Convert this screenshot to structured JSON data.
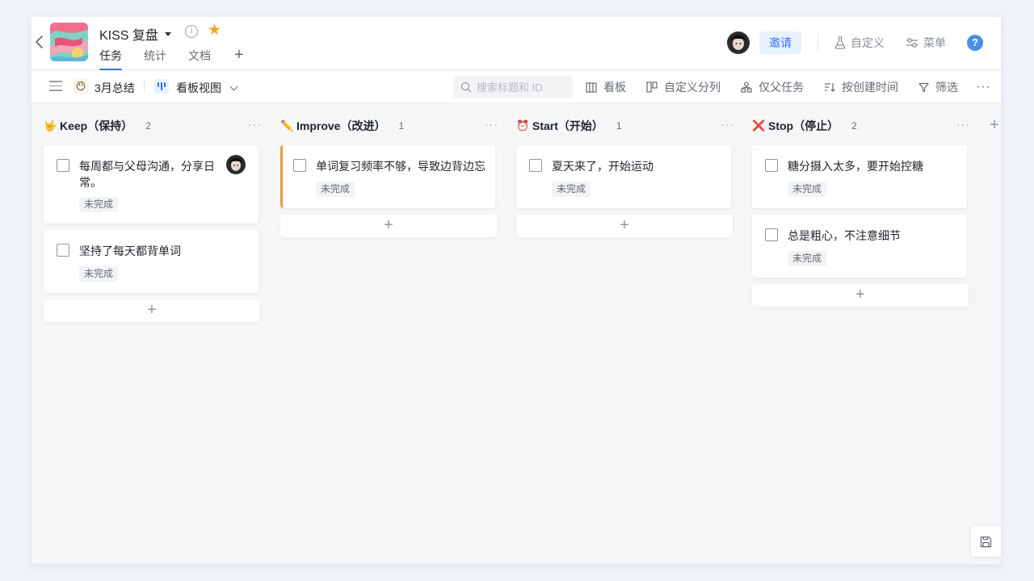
{
  "project": {
    "title": "KISS 复盘",
    "tabs": [
      {
        "label": "任务",
        "active": true
      },
      {
        "label": "统计",
        "active": false
      },
      {
        "label": "文档",
        "active": false
      }
    ],
    "add_tab": "+"
  },
  "header": {
    "invite_label": "邀请",
    "customize_label": "自定义",
    "menu_label": "菜单",
    "help_label": "?"
  },
  "toolbar": {
    "summary_emoji": "😶",
    "summary_label": "3月总结",
    "view_label": "看板视图",
    "search_placeholder": "搜索标题和 ID",
    "actions": [
      {
        "label": "看板",
        "icon": "board-icon"
      },
      {
        "label": "自定义分列",
        "icon": "columns-icon"
      },
      {
        "label": "仅父任务",
        "icon": "hierarchy-icon"
      },
      {
        "label": "按创建时间",
        "icon": "sort-icon"
      },
      {
        "label": "筛选",
        "icon": "filter-icon"
      }
    ],
    "more_label": "···"
  },
  "board": {
    "columns": [
      {
        "emoji": "🤟",
        "title": "Keep（保持）",
        "count": "2",
        "cards": [
          {
            "text_lines": [
              "每周都与父母沟通，分享日",
              "常。"
            ],
            "status": "未完成",
            "has_avatar": true
          },
          {
            "text_lines": [
              "坚持了每天都背单词"
            ],
            "status": "未完成",
            "has_avatar": false
          }
        ]
      },
      {
        "emoji": "✏️",
        "title": "Improve（改进）",
        "count": "1",
        "cards": [
          {
            "text_lines": [
              "单词复习频率不够，导致边背边忘"
            ],
            "status": "未完成",
            "has_avatar": false
          }
        ]
      },
      {
        "emoji": "⏰",
        "title": "Start（开始）",
        "count": "1",
        "cards": [
          {
            "text_lines": [
              "夏天来了，开始运动"
            ],
            "status": "未完成",
            "has_avatar": false
          }
        ]
      },
      {
        "emoji": "❌",
        "title": "Stop（停止）",
        "count": "2",
        "cards": [
          {
            "text_lines": [
              "糖分摄入太多，要开始控糖"
            ],
            "status": "未完成",
            "has_avatar": false
          },
          {
            "text_lines": [
              "总是粗心，不注意细节"
            ],
            "status": "未完成",
            "has_avatar": false
          }
        ]
      }
    ],
    "add_symbol": "+",
    "more_symbol": "···"
  },
  "colors": {
    "accent": "#3370ff",
    "improve_accent": "#f09a37",
    "star": "#f5a623",
    "help": "#4a90e2"
  }
}
